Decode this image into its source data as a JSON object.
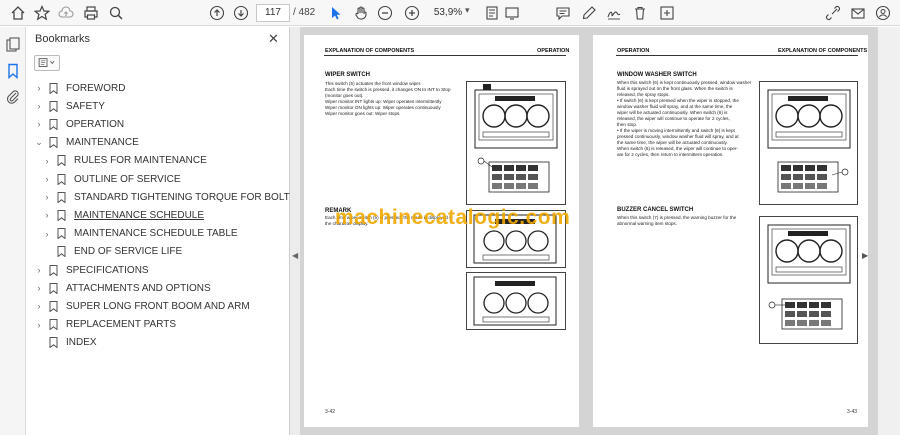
{
  "toolbar": {
    "page_current": "117",
    "page_total": "/ 482",
    "zoom": "53,9%"
  },
  "bookmarks": {
    "title": "Bookmarks",
    "items": [
      {
        "label": "FOREWORD",
        "level": 0,
        "caret": "›"
      },
      {
        "label": "SAFETY",
        "level": 0,
        "caret": "›"
      },
      {
        "label": "OPERATION",
        "level": 0,
        "caret": "›"
      },
      {
        "label": "MAINTENANCE",
        "level": 0,
        "caret": "⌄"
      },
      {
        "label": "RULES FOR MAINTENANCE",
        "level": 1,
        "caret": "›"
      },
      {
        "label": "OUTLINE OF SERVICE",
        "level": 1,
        "caret": "›"
      },
      {
        "label": "STANDARD TIGHTENING TORQUE FOR BOLTS AND NUTS",
        "level": 1,
        "caret": "›"
      },
      {
        "label": "MAINTENANCE SCHEDULE",
        "level": 1,
        "caret": "›",
        "underline": true
      },
      {
        "label": "MAINTENANCE SCHEDULE TABLE",
        "level": 1,
        "caret": "›"
      },
      {
        "label": "END OF SERVICE LIFE",
        "level": 1,
        "caret": ""
      },
      {
        "label": "SPECIFICATIONS",
        "level": 0,
        "caret": "›"
      },
      {
        "label": "ATTACHMENTS AND OPTIONS",
        "level": 0,
        "caret": "›"
      },
      {
        "label": "SUPER LONG FRONT BOOM AND ARM",
        "level": 0,
        "caret": "›"
      },
      {
        "label": "REPLACEMENT PARTS",
        "level": 0,
        "caret": "›"
      },
      {
        "label": "INDEX",
        "level": 0,
        "caret": ""
      }
    ]
  },
  "left_page": {
    "header_left": "EXPLANATION OF COMPONENTS",
    "header_right": "OPERATION",
    "sec1_title": "WIPER SWITCH",
    "sec1_lines": [
      "This switch (5) actuates the front window wiper.",
      "Each time the switch is pressed, it changes ON to INT to Stop",
      "(monitor goes out).",
      "Wiper monitor INT lights up: Wiper operates intermittently",
      "Wiper monitor ON lights up: Wiper operates continuously",
      "Wiper monitor goes out: Wiper stops."
    ],
    "sec2_title": "REMARK",
    "sec2_lines": [
      "Each time wiper switch (5) is pressed, the mode is displayed in",
      "the character display."
    ],
    "page_number": "3-42"
  },
  "right_page": {
    "header_left": "OPERATION",
    "header_right": "EXPLANATION OF COMPONENTS",
    "sec1_title": "WINDOW WASHER SWITCH",
    "sec1_lines": [
      "When this switch (6) is kept continuously pressed, window washer",
      "fluid is sprayed out on the front glass. When the switch is",
      "released, the spray stops.",
      "• If switch (6) is kept pressed when the wiper is stopped, the",
      "  window washer fluid will spray, and at the same time, the",
      "  wiper will be actuated continuously. When switch (6) is",
      "  released, the wiper will continue to operate for 2 cycles,",
      "  then stop.",
      "• If the wiper is moving intermittently and switch (6) is kept",
      "  pressed continuously, window washer fluid will spray, and at",
      "  the same time, the wiper will be actuated continuously.",
      "  When switch (6) is released, the wiper will continue to oper-",
      "  ate for 2 cycles, then return to intermittent operation."
    ],
    "sec2_title": "BUZZER CANCEL SWITCH",
    "sec2_lines": [
      "When this switch (7) is pressed, the warning buzzer for the",
      "abnormal warning item stops."
    ],
    "page_number": "3-43"
  },
  "watermark": "machinecatalogic.com",
  "colors": {
    "accent": "#1a73e8",
    "watermark": "#f0a800",
    "doc_background": "#d4d4d4"
  }
}
